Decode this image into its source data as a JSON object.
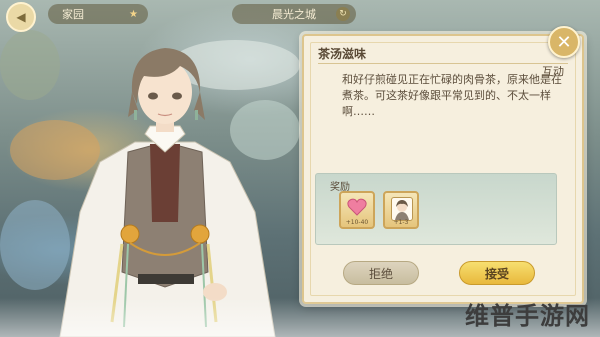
{
  "topbar": {
    "home_tab": "家园",
    "day_tab": "晨光之城"
  },
  "dialog": {
    "title": "茶汤滋味",
    "type_label": "互动",
    "story": "和好仔煎碰见正在忙碌的肉骨茶，原来他是在煮茶。可这茶好像跟平常见到的、不太一样啊……",
    "reward_label": "奖励",
    "rewards": [
      {
        "icon": "heart-icon",
        "count": "+10-40"
      },
      {
        "icon": "portrait-card-icon",
        "count": "+1-3"
      }
    ],
    "decline_label": "拒绝",
    "accept_label": "接受"
  },
  "watermark": "维普手游网",
  "colors": {
    "dialog_bg": "#f6efde",
    "accent_gold": "#e8b83c",
    "reward_panel": "#c8d7cc"
  }
}
